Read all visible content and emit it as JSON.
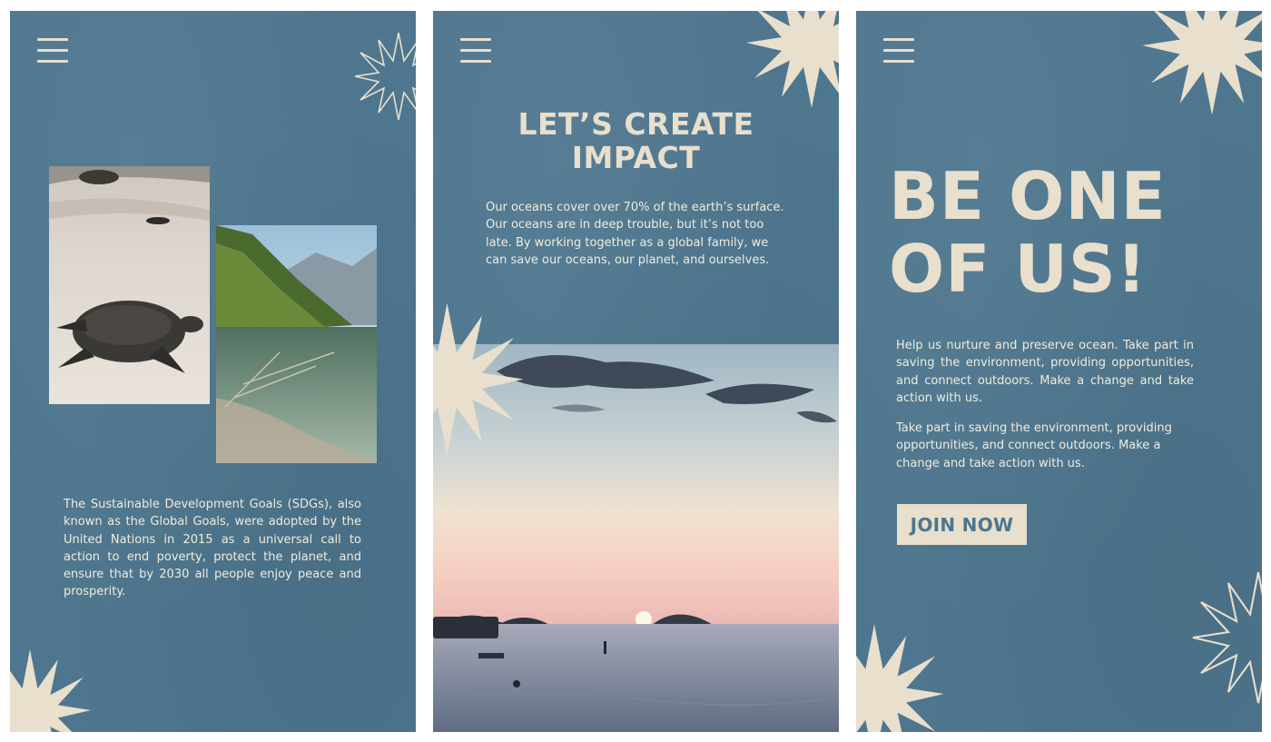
{
  "panel1": {
    "menu_label": "Menu",
    "body": "The Sustainable Development Goals (SDGs), also known as the Global Goals, were adopted by the United Nations in 2015 as a universal call to action to end poverty, protect the planet, and ensure that by 2030 all people enjoy peace and prosperity."
  },
  "panel2": {
    "headline_line1": "LET’S CREATE",
    "headline_line2": "IMPACT",
    "body": "Our oceans cover over 70% of the earth’s surface. Our oceans are in deep trouble, but it’s not too late. By working together as a global family, we can save our oceans, our planet, and ourselves."
  },
  "panel3": {
    "headline_line1": "BE ONE",
    "headline_line2": "OF US!",
    "body1": "Help us nurture and preserve ocean. Take part in saving the environment, providing opportunities, and connect outdoors. Make a change and take action with us.",
    "body2": "Take part in saving the environment, providing opportunities, and connect outdoors. Make a change and take action with us.",
    "button_label": "JOIN NOW"
  },
  "icons": {
    "menu": "hamburger-menu-icon",
    "burst": "starburst-decoration"
  },
  "colors": {
    "background": "#4e768e",
    "cream": "#e8dfcd",
    "text": "#f1ebdd"
  }
}
